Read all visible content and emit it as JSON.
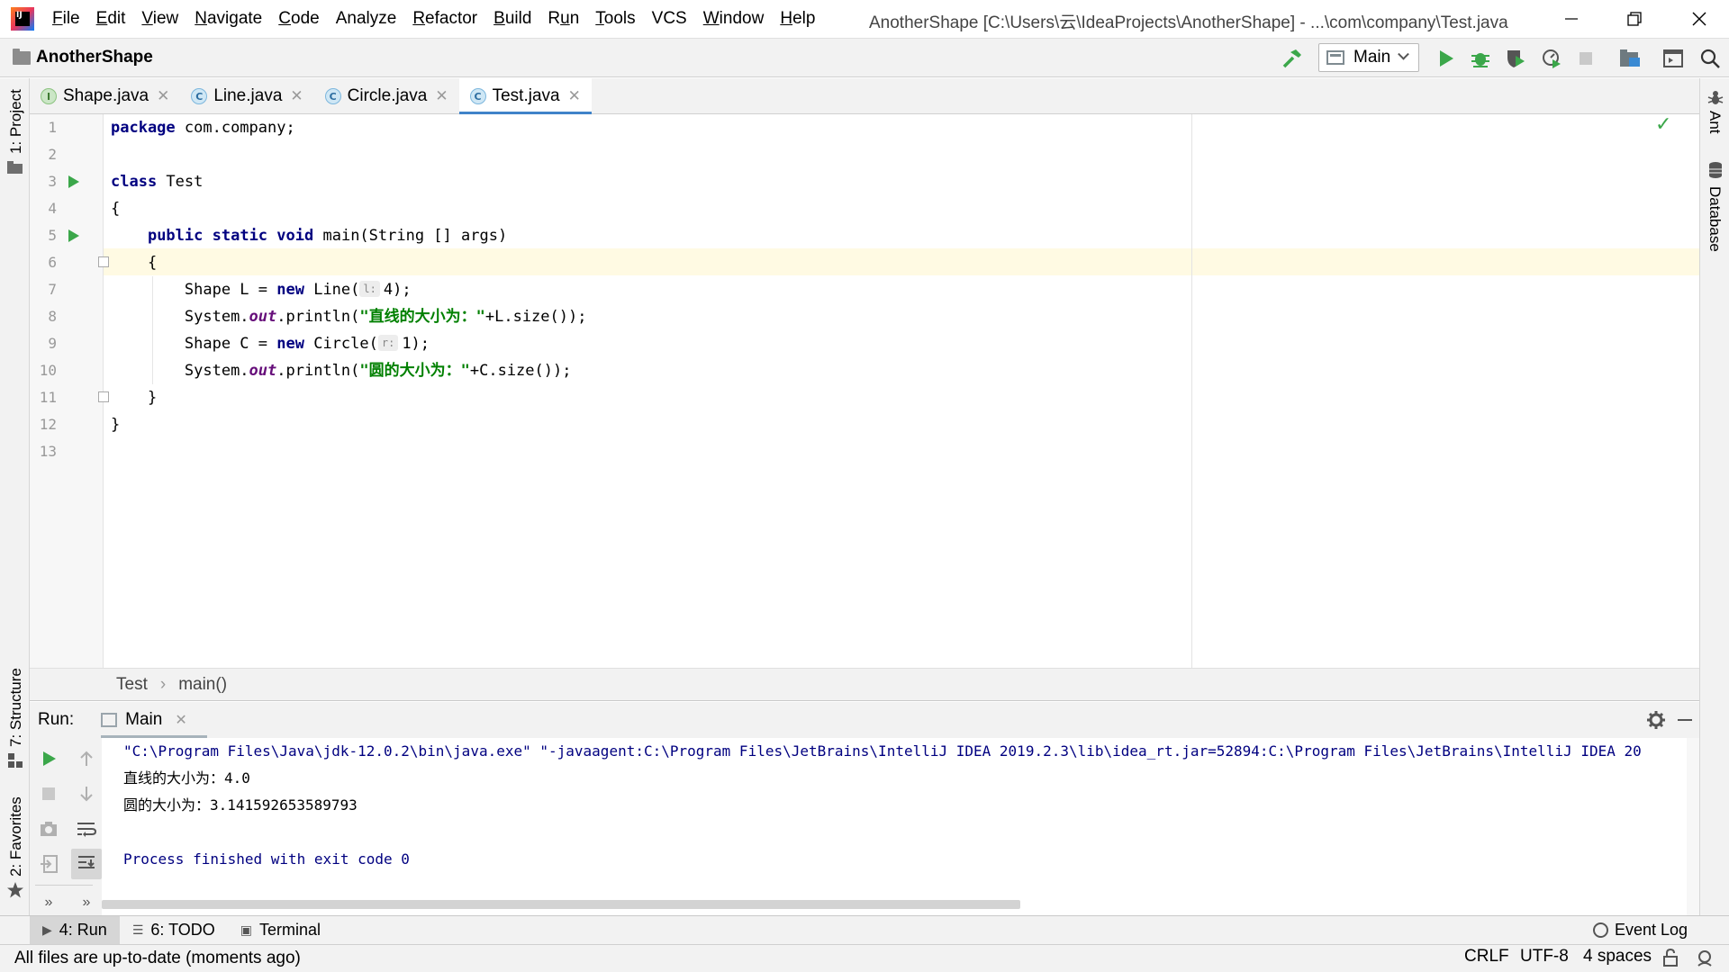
{
  "menubar": {
    "items": [
      {
        "label": "File",
        "mnemonic": "F"
      },
      {
        "label": "Edit",
        "mnemonic": "E"
      },
      {
        "label": "View",
        "mnemonic": "V"
      },
      {
        "label": "Navigate",
        "mnemonic": "N"
      },
      {
        "label": "Code",
        "mnemonic": "C"
      },
      {
        "label": "Analyze"
      },
      {
        "label": "Refactor",
        "mnemonic": "R"
      },
      {
        "label": "Build",
        "mnemonic": "B"
      },
      {
        "label": "Run",
        "mnemonic": "u"
      },
      {
        "label": "Tools",
        "mnemonic": "T"
      },
      {
        "label": "VCS"
      },
      {
        "label": "Window",
        "mnemonic": "W"
      },
      {
        "label": "Help",
        "mnemonic": "H"
      }
    ],
    "window_title": "AnotherShape [C:\\Users\\云\\IdeaProjects\\AnotherShape] - ...\\com\\company\\Test.java"
  },
  "navbar": {
    "project": "AnotherShape",
    "run_config": "Main"
  },
  "side_stripes": {
    "left_top": "1: Project",
    "left_structure": "7: Structure",
    "left_favorites": "2: Favorites",
    "right_ant": "Ant",
    "right_database": "Database"
  },
  "editor_tabs": [
    {
      "label": "Shape.java",
      "kind": "interface",
      "icon_letter": "I"
    },
    {
      "label": "Line.java",
      "kind": "class",
      "icon_letter": "C"
    },
    {
      "label": "Circle.java",
      "kind": "class",
      "icon_letter": "C"
    },
    {
      "label": "Test.java",
      "kind": "class",
      "icon_letter": "C",
      "active": true
    }
  ],
  "editor": {
    "line_numbers": [
      "1",
      "2",
      "3",
      "4",
      "5",
      "6",
      "7",
      "8",
      "9",
      "10",
      "11",
      "12",
      "13"
    ],
    "code": {
      "l1_kw": "package",
      "l1_rest": " com.company;",
      "l3_kw": "class",
      "l3_rest": " Test",
      "l4": "{",
      "l5_kw1": "public",
      "l5_kw2": "static",
      "l5_kw3": "void",
      "l5_rest": " main(String [] args)",
      "l6": "{",
      "l7_pre": "Shape L = ",
      "l7_kw": "new",
      "l7_mid": " Line(",
      "l7_hint": "l:",
      "l7_end": "4);",
      "l8_pre": "System.",
      "l8_fld": "out",
      "l8_mid": ".println(",
      "l8_str": "\"直线的大小为：\"",
      "l8_end": "+L.size());",
      "l9_pre": "Shape C = ",
      "l9_kw": "new",
      "l9_mid": " Circle(",
      "l9_hint": "r:",
      "l9_end": "1);",
      "l10_pre": "System.",
      "l10_fld": "out",
      "l10_mid": ".println(",
      "l10_str": "\"圆的大小为：\"",
      "l10_end": "+C.size());",
      "l11": "}",
      "l12": "}"
    }
  },
  "breadcrumbs": [
    "Test",
    "main()"
  ],
  "run_panel": {
    "title": "Run:",
    "tab": "Main",
    "console": [
      "\"C:\\Program Files\\Java\\jdk-12.0.2\\bin\\java.exe\" \"-javaagent:C:\\Program Files\\JetBrains\\IntelliJ IDEA 2019.2.3\\lib\\idea_rt.jar=52894:C:\\Program Files\\JetBrains\\IntelliJ IDEA 20",
      "直线的大小为：4.0",
      "圆的大小为：3.141592653589793",
      "Process finished with exit code 0"
    ]
  },
  "bottom_tabs": [
    {
      "label": "4: Run",
      "active": true
    },
    {
      "label": "6: TODO"
    },
    {
      "label": "Terminal"
    }
  ],
  "event_log": "Event Log",
  "statusbar": {
    "message": "All files are up-to-date (moments ago)",
    "line_sep": "CRLF",
    "encoding": "UTF-8",
    "indent": "4 spaces"
  }
}
